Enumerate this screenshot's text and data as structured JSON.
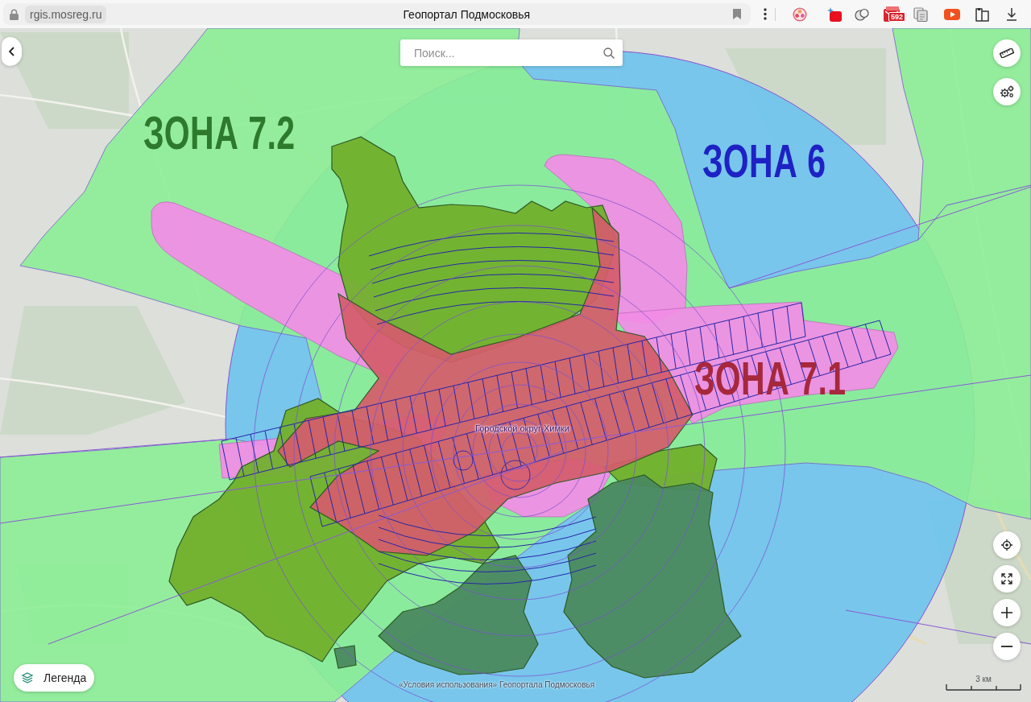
{
  "browser": {
    "url": "rgis.mosreg.ru",
    "title": "Геопортал Подмосковья",
    "extension_badge": "592"
  },
  "map": {
    "search": {
      "placeholder": "Поиск..."
    },
    "zone_labels": [
      {
        "text": "ЗОНА 7.2",
        "color": "#2e7a2c"
      },
      {
        "text": "ЗОНА 6",
        "color": "#1e22c4"
      },
      {
        "text": "ЗОНА 7.1",
        "color": "#a6283c"
      }
    ],
    "district_label": "Городской округ Химки",
    "legend_button": "Легенда",
    "attribution": "«Условия использования» Геопортала Подмосковья",
    "scale": "3 км"
  }
}
